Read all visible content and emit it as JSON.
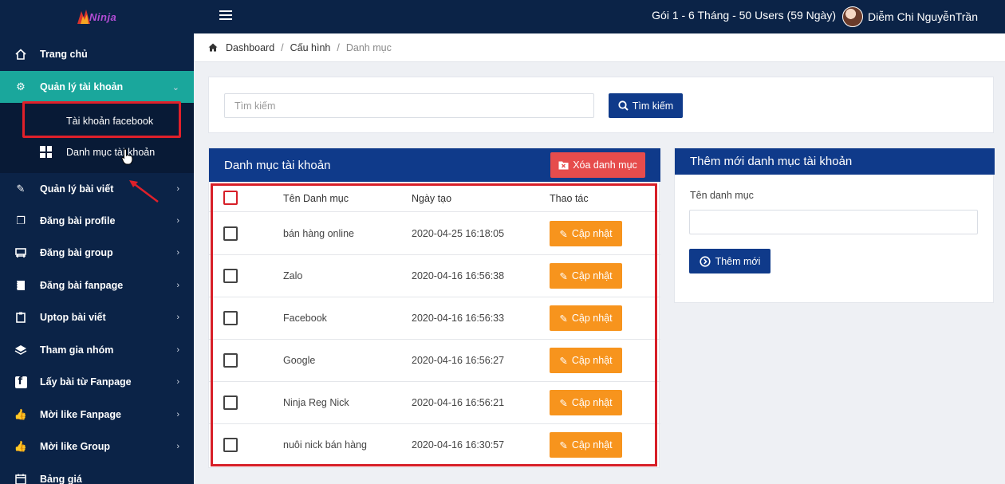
{
  "topbar": {
    "logo_text": "Ninja",
    "plan": "Gói 1 - 6 Tháng - 50 Users (59 Ngày)",
    "user_name": "Diễm Chi NguyễnTrần"
  },
  "sidebar": {
    "items": [
      {
        "label": "Trang chủ",
        "icon": "home-icon"
      },
      {
        "label": "Quản lý tài khoản",
        "icon": "gear-icon"
      },
      {
        "label": "Quản lý bài viết",
        "icon": "pencil-icon"
      },
      {
        "label": "Đăng bài profile",
        "icon": "copy-icon"
      },
      {
        "label": "Đăng bài group",
        "icon": "group-icon"
      },
      {
        "label": "Đăng bài fanpage",
        "icon": "notebook-icon"
      },
      {
        "label": "Uptop bài viết",
        "icon": "clipboard-icon"
      },
      {
        "label": "Tham gia nhóm",
        "icon": "layers-icon"
      },
      {
        "label": "Lấy bài từ Fanpage",
        "icon": "facebook-icon"
      },
      {
        "label": "Mời like Fanpage",
        "icon": "thumbs-up-icon"
      },
      {
        "label": "Mời like Group",
        "icon": "thumbs-up-icon"
      },
      {
        "label": "Bảng giá",
        "icon": "calendar-icon"
      }
    ],
    "submenu": [
      {
        "label": "Tài khoản facebook",
        "icon": "facebook-icon"
      },
      {
        "label": "Danh mục tài khoản",
        "icon": "grid-icon"
      }
    ]
  },
  "breadcrumb": {
    "items": [
      "Dashboard",
      "Cấu hình",
      "Danh mục"
    ]
  },
  "search": {
    "placeholder": "Tìm kiếm",
    "button_label": "Tìm kiếm"
  },
  "list": {
    "title": "Danh mục tài khoản",
    "delete_label": "Xóa danh mục",
    "columns": [
      "Tên Danh mục",
      "Ngày tạo",
      "Thao tác"
    ],
    "update_label": "Cập nhật",
    "rows": [
      {
        "name": "bán hàng online",
        "date": "2020-04-25 16:18:05"
      },
      {
        "name": "Zalo",
        "date": "2020-04-16 16:56:38"
      },
      {
        "name": "Facebook",
        "date": "2020-04-16 16:56:33"
      },
      {
        "name": "Google",
        "date": "2020-04-16 16:56:27"
      },
      {
        "name": "Ninja Reg Nick",
        "date": "2020-04-16 16:56:21"
      },
      {
        "name": "nuôi nick bán hàng",
        "date": "2020-04-16 16:30:57"
      }
    ]
  },
  "add_form": {
    "title": "Thêm mới danh mục tài khoản",
    "label": "Tên danh mục",
    "value": "",
    "button_label": "Thêm mới"
  },
  "colors": {
    "navy": "#0b2347",
    "primary": "#0f3a8a",
    "teal_active": "#1aa79c",
    "danger": "#e64c4c",
    "warning": "#f7941d",
    "highlight_red": "#d71f28"
  }
}
